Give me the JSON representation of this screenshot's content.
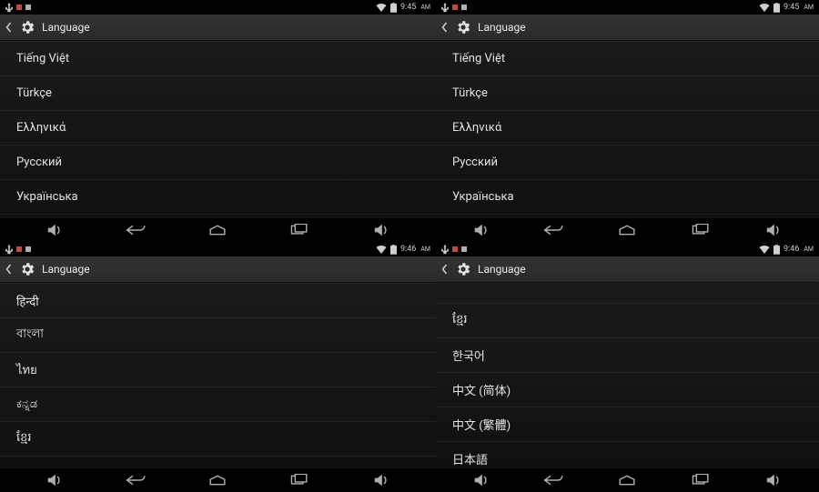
{
  "panels": [
    {
      "status": {
        "time": "9:45",
        "ampm": "AM"
      },
      "header": {
        "title": "Language"
      },
      "scrollTop": 0,
      "items": [
        "Tiếng Việt",
        "Türkçe",
        "Ελληνικά",
        "Русский",
        "Українська"
      ]
    },
    {
      "status": {
        "time": "9:45",
        "ampm": "AM"
      },
      "header": {
        "title": "Language"
      },
      "scrollTop": 0,
      "items": [
        "Tiếng Việt",
        "Türkçe",
        "Ελληνικά",
        "Русский",
        "Українська"
      ]
    },
    {
      "status": {
        "time": "9:46",
        "ampm": "AM"
      },
      "header": {
        "title": "Language"
      },
      "scrollTop": 0,
      "items": [
        "हिन्दी",
        "বাংলা",
        "ไทย",
        "ಕನ್ನಡ",
        "ខ្មែរ"
      ]
    },
    {
      "status": {
        "time": "9:46",
        "ampm": "AM"
      },
      "header": {
        "title": "Language"
      },
      "scrollTop": 22,
      "items": [
        "ខ្មែរ",
        "한국어",
        "中文 (简体)",
        "中文 (繁體)",
        "日本語"
      ]
    }
  ]
}
